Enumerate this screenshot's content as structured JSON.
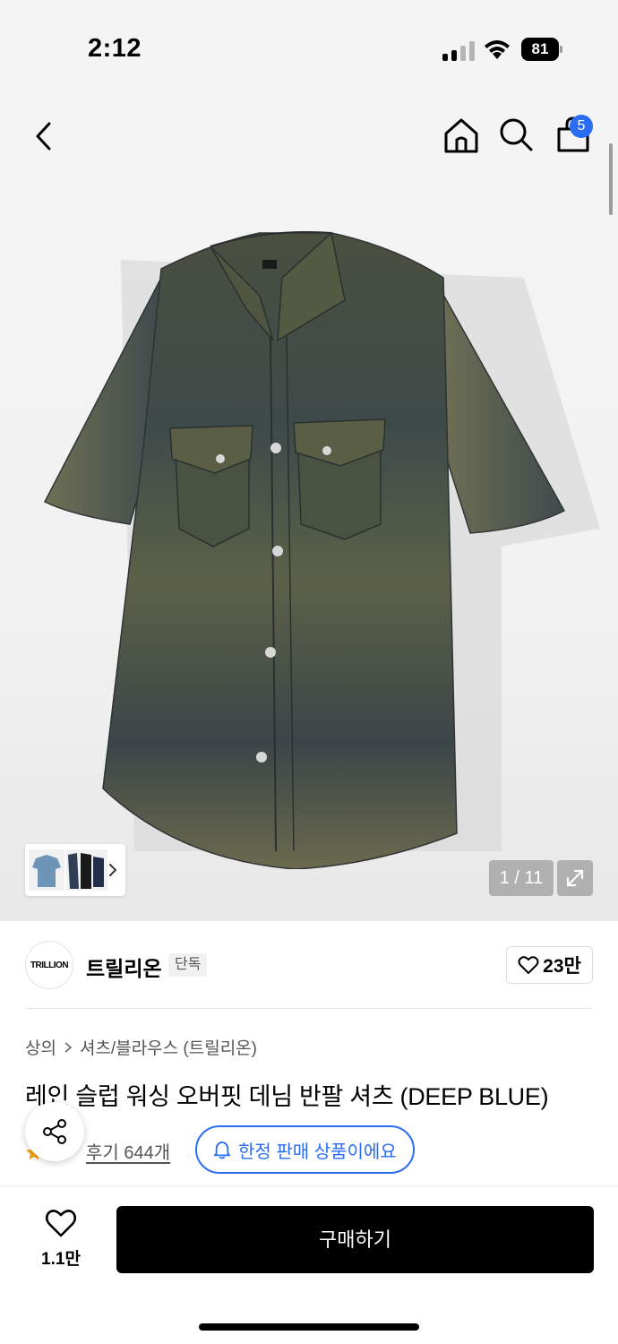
{
  "status_bar": {
    "time": "2:12",
    "battery": "81"
  },
  "nav": {
    "cart_count": "5"
  },
  "gallery": {
    "counter": "1 / 11"
  },
  "brand": {
    "logo_text": "TRILLION",
    "name": "트릴리온",
    "tag": "단독",
    "likes": "23만"
  },
  "breadcrumb": {
    "category": "상의",
    "subcategory": "셔츠/블라우스 (트릴리온)"
  },
  "product": {
    "title": "레인 슬럽 워싱 오버핏 데님 반팔 셔츠 (DEEP BLUE)",
    "reviews": "후기 644개",
    "limited_notice": "한정 판매 상품이에요"
  },
  "bottom_bar": {
    "wish_count": "1.1만",
    "buy_label": "구매하기"
  },
  "colors": {
    "accent": "#2a6df4",
    "buy_button": "#000000"
  },
  "icons": [
    "back-icon",
    "home-icon",
    "search-icon",
    "bag-icon",
    "expand-icon",
    "heart-icon",
    "share-icon",
    "bell-icon",
    "star-icon"
  ]
}
